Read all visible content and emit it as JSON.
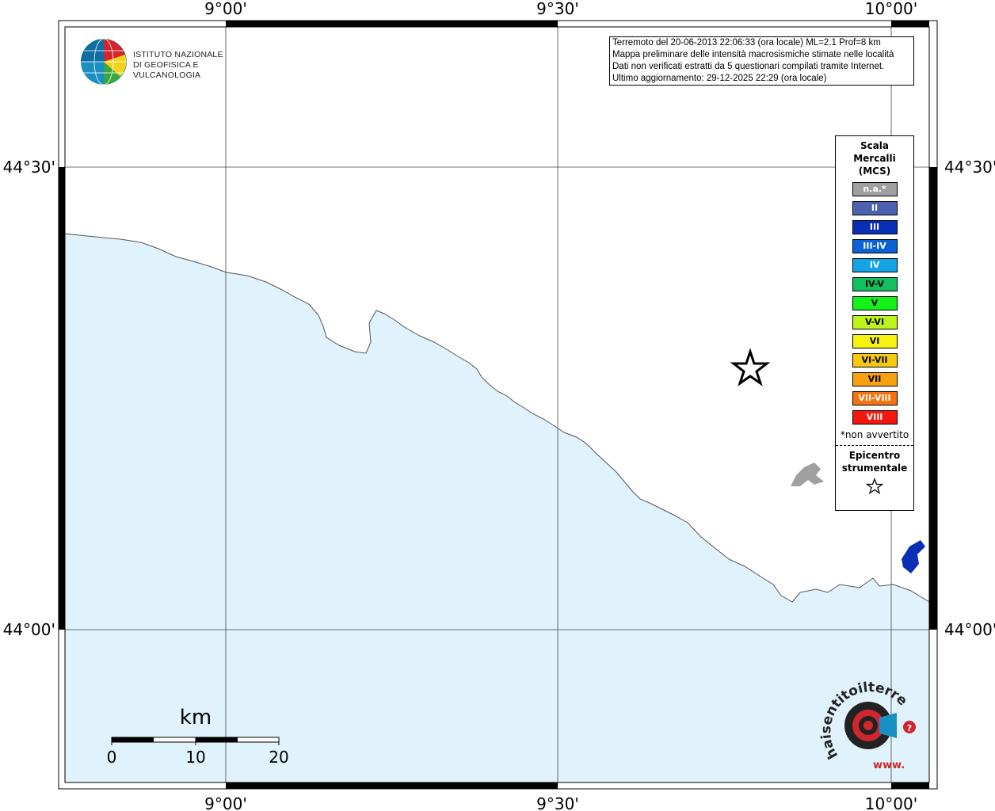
{
  "info": {
    "lines": [
      "Terremoto del 20-06-2013 22:06:33 (ora locale) ML=2.1 Prof=8 km",
      "Mappa preliminare delle intensità macrosismiche stimate nelle località",
      "Dati non verificati estratti da 5 questionari compilati tramite Internet.",
      "Ultimo aggiornamento: 29-12-2025 22:29 (ora locale)"
    ]
  },
  "logo": {
    "line1": "ISTITUTO NAZIONALE",
    "line2": "DI GEOFISICA E VULCANOLOGIA"
  },
  "axes": {
    "lon_labels": [
      "9°00'",
      "9°30'",
      "10°00'"
    ],
    "lat_labels": [
      "44°30'",
      "44°00'"
    ]
  },
  "scale_bar": {
    "unit": "km",
    "labels": [
      "0",
      "10",
      "20"
    ]
  },
  "legend": {
    "title": [
      "Scala",
      "Mercalli",
      "(MCS)"
    ],
    "classes": [
      {
        "label": "n.a.*",
        "color": "#A0A0A0",
        "text": "#ffffff"
      },
      {
        "label": "II",
        "color": "#4C62B0",
        "text": "#ffffff"
      },
      {
        "label": "III",
        "color": "#0A2FB5",
        "text": "#ffffff"
      },
      {
        "label": "III-IV",
        "color": "#0B62D6",
        "text": "#ffffff"
      },
      {
        "label": "IV",
        "color": "#13A4E6",
        "text": "#ffffff"
      },
      {
        "label": "IV-V",
        "color": "#11C061",
        "text": "#000000"
      },
      {
        "label": "V",
        "color": "#14F21A",
        "text": "#000000"
      },
      {
        "label": "V-VI",
        "color": "#BDF51A",
        "text": "#000000"
      },
      {
        "label": "VI",
        "color": "#F7F30F",
        "text": "#000000"
      },
      {
        "label": "VI-VII",
        "color": "#F7C90F",
        "text": "#000000"
      },
      {
        "label": "VII",
        "color": "#F7A10F",
        "text": "#000000"
      },
      {
        "label": "VII-VIII",
        "color": "#F5720E",
        "text": "#ffffff"
      },
      {
        "label": "VIII",
        "color": "#F5160E",
        "text": "#ffffff"
      }
    ],
    "note": "*non avvertito",
    "epicentre_title": [
      "Epicentro",
      "strumentale"
    ]
  },
  "colors": {
    "sea": "#E0F2FC",
    "land": "#FFFFFF",
    "coast": "#555555",
    "urban": "#A0A0A0",
    "lake": "#0A2FB5"
  },
  "badge": {
    "text": "haisentitoilterremoto.it",
    "prefix": "www."
  }
}
